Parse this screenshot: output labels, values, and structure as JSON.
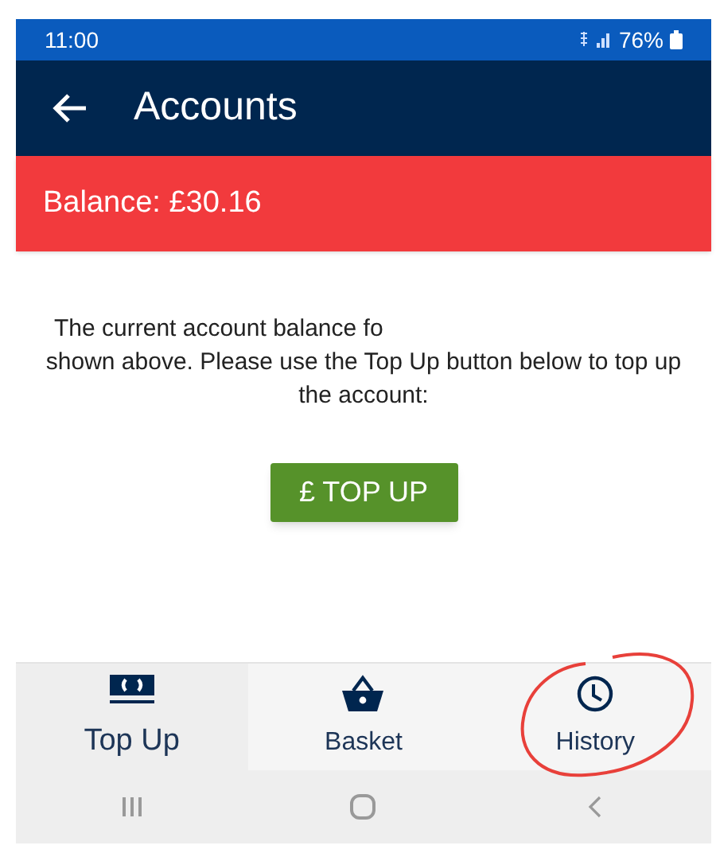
{
  "status_bar": {
    "time": "11:00",
    "battery": "76%"
  },
  "app_bar": {
    "title": "Accounts"
  },
  "balance_banner": {
    "text": "Balance: £30.16"
  },
  "message": {
    "line_1": "The current account balance fo",
    "rest": "shown above. Please use the Top Up button below to top up the account:"
  },
  "top_up_button": {
    "label": "£ TOP UP"
  },
  "bottom_nav": [
    {
      "label": "Top Up",
      "kind": "money",
      "selected": true
    },
    {
      "label": "Basket",
      "kind": "basket",
      "selected": false
    },
    {
      "label": "History",
      "kind": "clock",
      "selected": false
    }
  ]
}
